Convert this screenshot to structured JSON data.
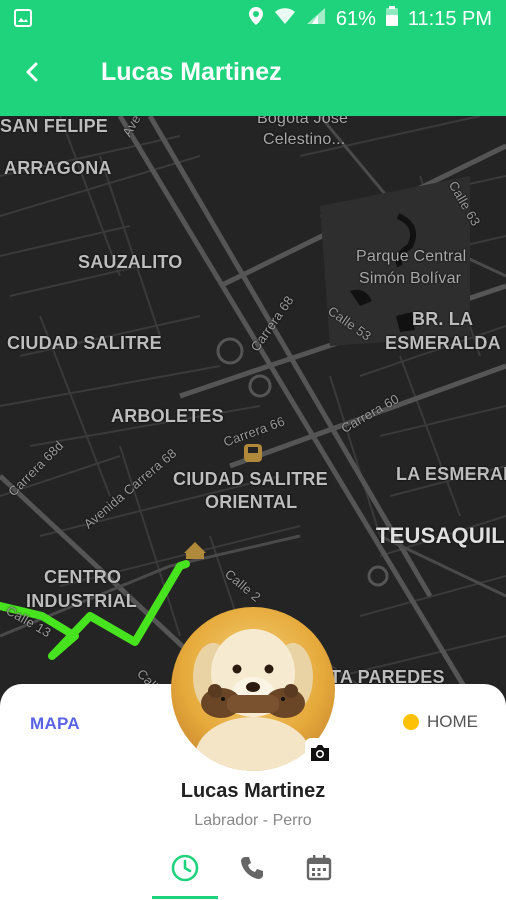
{
  "status_bar": {
    "battery_text": "61%",
    "time": "11:15 PM"
  },
  "toolbar": {
    "title": "Lucas Martinez"
  },
  "map": {
    "labels": {
      "san_felipe": "SAN FELIPE",
      "tarragona": "ARRAGONA",
      "sauzalito": "SAUZALITO",
      "ciudad_salitre": "CIUDAD SALITRE",
      "arboletes": "ARBOLETES",
      "ciudad_salitre_oriental_1": "CIUDAD SALITRE",
      "ciudad_salitre_oriental_2": "ORIENTAL",
      "centro_industrial_1": "CENTRO",
      "centro_industrial_2": "INDUSTRIAL",
      "teusaquillo": "TEUSAQUIL",
      "la_esmeralda": "LA ESMERAL",
      "br_la_esmeralda_1": "BR. LA",
      "br_la_esmeralda_2": "ESMERALDA",
      "parque_1": "Parque Central",
      "parque_2": "Simón Bolívar",
      "bogota_jose_1": "Bogotá José",
      "bogota_jose_2": "Celestino...",
      "quinta_paredes": "TA PAREDES",
      "calle_63": "Calle 63",
      "calle_53": "Calle 53",
      "carrera_68": "Carrera 68",
      "carrera_66": "Carrera 66",
      "carrera_60": "Carrera 60",
      "carrera_68d": "Carrera 68d",
      "avenida_carrera_68": "Avenida Carrera 68",
      "calle_2": "Calle 2",
      "calle_13": "Calle 13",
      "ave": "Ave",
      "call": "Call"
    }
  },
  "sheet": {
    "left_tab": "MAPA",
    "home_label": "HOME",
    "pet_name": "Lucas Martinez",
    "pet_breed": "Labrador - Perro"
  },
  "colors": {
    "brand": "#1fd37c",
    "mapa_link": "#5a63e6",
    "home_dot": "#ffc107",
    "route": "#48e31f"
  },
  "icons": {
    "tabs": [
      "clock-icon",
      "phone-icon",
      "calendar-icon"
    ],
    "camera": "camera-icon"
  }
}
